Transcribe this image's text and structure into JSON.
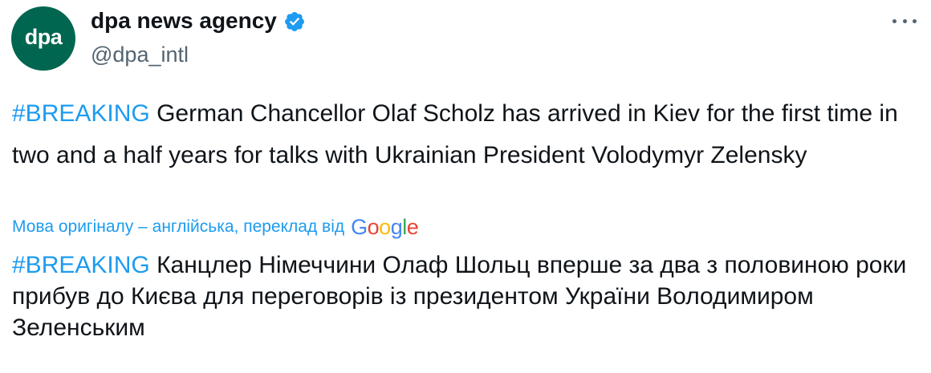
{
  "account": {
    "display_name": "dpa news agency",
    "handle": "@dpa_intl",
    "avatar_text": "dpa",
    "verified": true
  },
  "tweet": {
    "hashtag": "#BREAKING",
    "text": " German Chancellor Olaf Scholz has arrived in Kiev for the first time in two and a half years for talks with Ukrainian President Volodymyr Zelensky"
  },
  "translation": {
    "label": "Мова оригіналу – англійська, переклад від",
    "provider": "Google",
    "hashtag": "#BREAKING",
    "text": " Канцлер Німеччини Олаф Шольц вперше за два з половиною роки прибув до Києва для переговорів із президентом України Володимиром Зеленським"
  },
  "icons": {
    "more": "more-horizontal-icon",
    "verified": "verified-badge-icon"
  },
  "colors": {
    "accent": "#1d9bf0",
    "avatar_bg": "#00664f",
    "text": "#0f1419",
    "secondary": "#536471"
  }
}
